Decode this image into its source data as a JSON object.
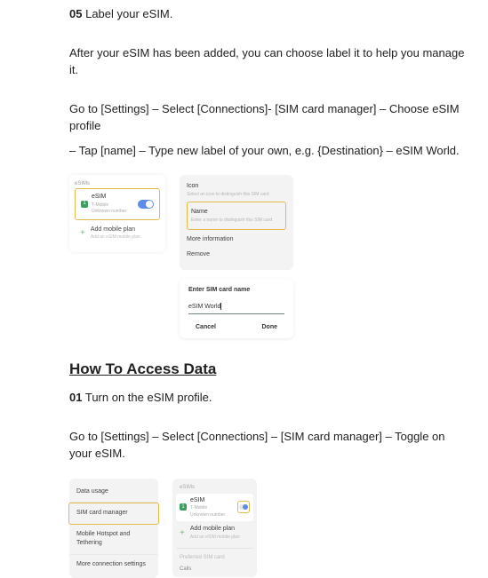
{
  "step05": {
    "num": "05",
    "title": "Label your eSIM."
  },
  "p_after": "After your eSIM has been added, you can choose label it to help you manage it.",
  "p_goto1": "Go to [Settings] – Select [Connections]- [SIM card manager] – Choose eSIM profile",
  "p_tap": "– Tap [name] – Type new label of your own, e.g. {Destination} – eSIM World.",
  "ill1": {
    "left": {
      "section": "eSIMs",
      "esim": "eSIM",
      "esim_sub1": "T-Mobile",
      "esim_sub2": "Unknown number",
      "add": "Add mobile plan",
      "add_sub": "Add an eSIM mobile plan"
    },
    "right": {
      "icon_title": "Icon",
      "icon_sub": "Select an icon to distinguish this SIM card",
      "name_title": "Name",
      "name_sub": "Enter a name to distinguish this SIM card",
      "more": "More information",
      "remove": "Remove",
      "pop_title": "Enter SIM card name",
      "pop_value": "eSIM World",
      "btn_cancel": "Cancel",
      "btn_done": "Done"
    }
  },
  "heading_access": "How To Access Data",
  "step01": {
    "num": "01",
    "title": "Turn on the eSIM profile."
  },
  "p_goto2": "Go to [Settings] – Select [Connections] – [SIM card manager] – Toggle on your eSIM.",
  "ill2": {
    "left": {
      "r1": "Data usage",
      "r2": "SIM card manager",
      "r3": "Mobile Hotspot and Tethering",
      "r4": "More connection settings"
    },
    "right": {
      "hdr": "eSIMs",
      "esim": "eSIM",
      "esim_s1": "T-Mobile",
      "esim_s2": "Unknown number",
      "add": "Add mobile plan",
      "add_sub": "Add an eSIM mobile plan",
      "pref": "Preferred SIM card",
      "calls": "Calls"
    }
  }
}
